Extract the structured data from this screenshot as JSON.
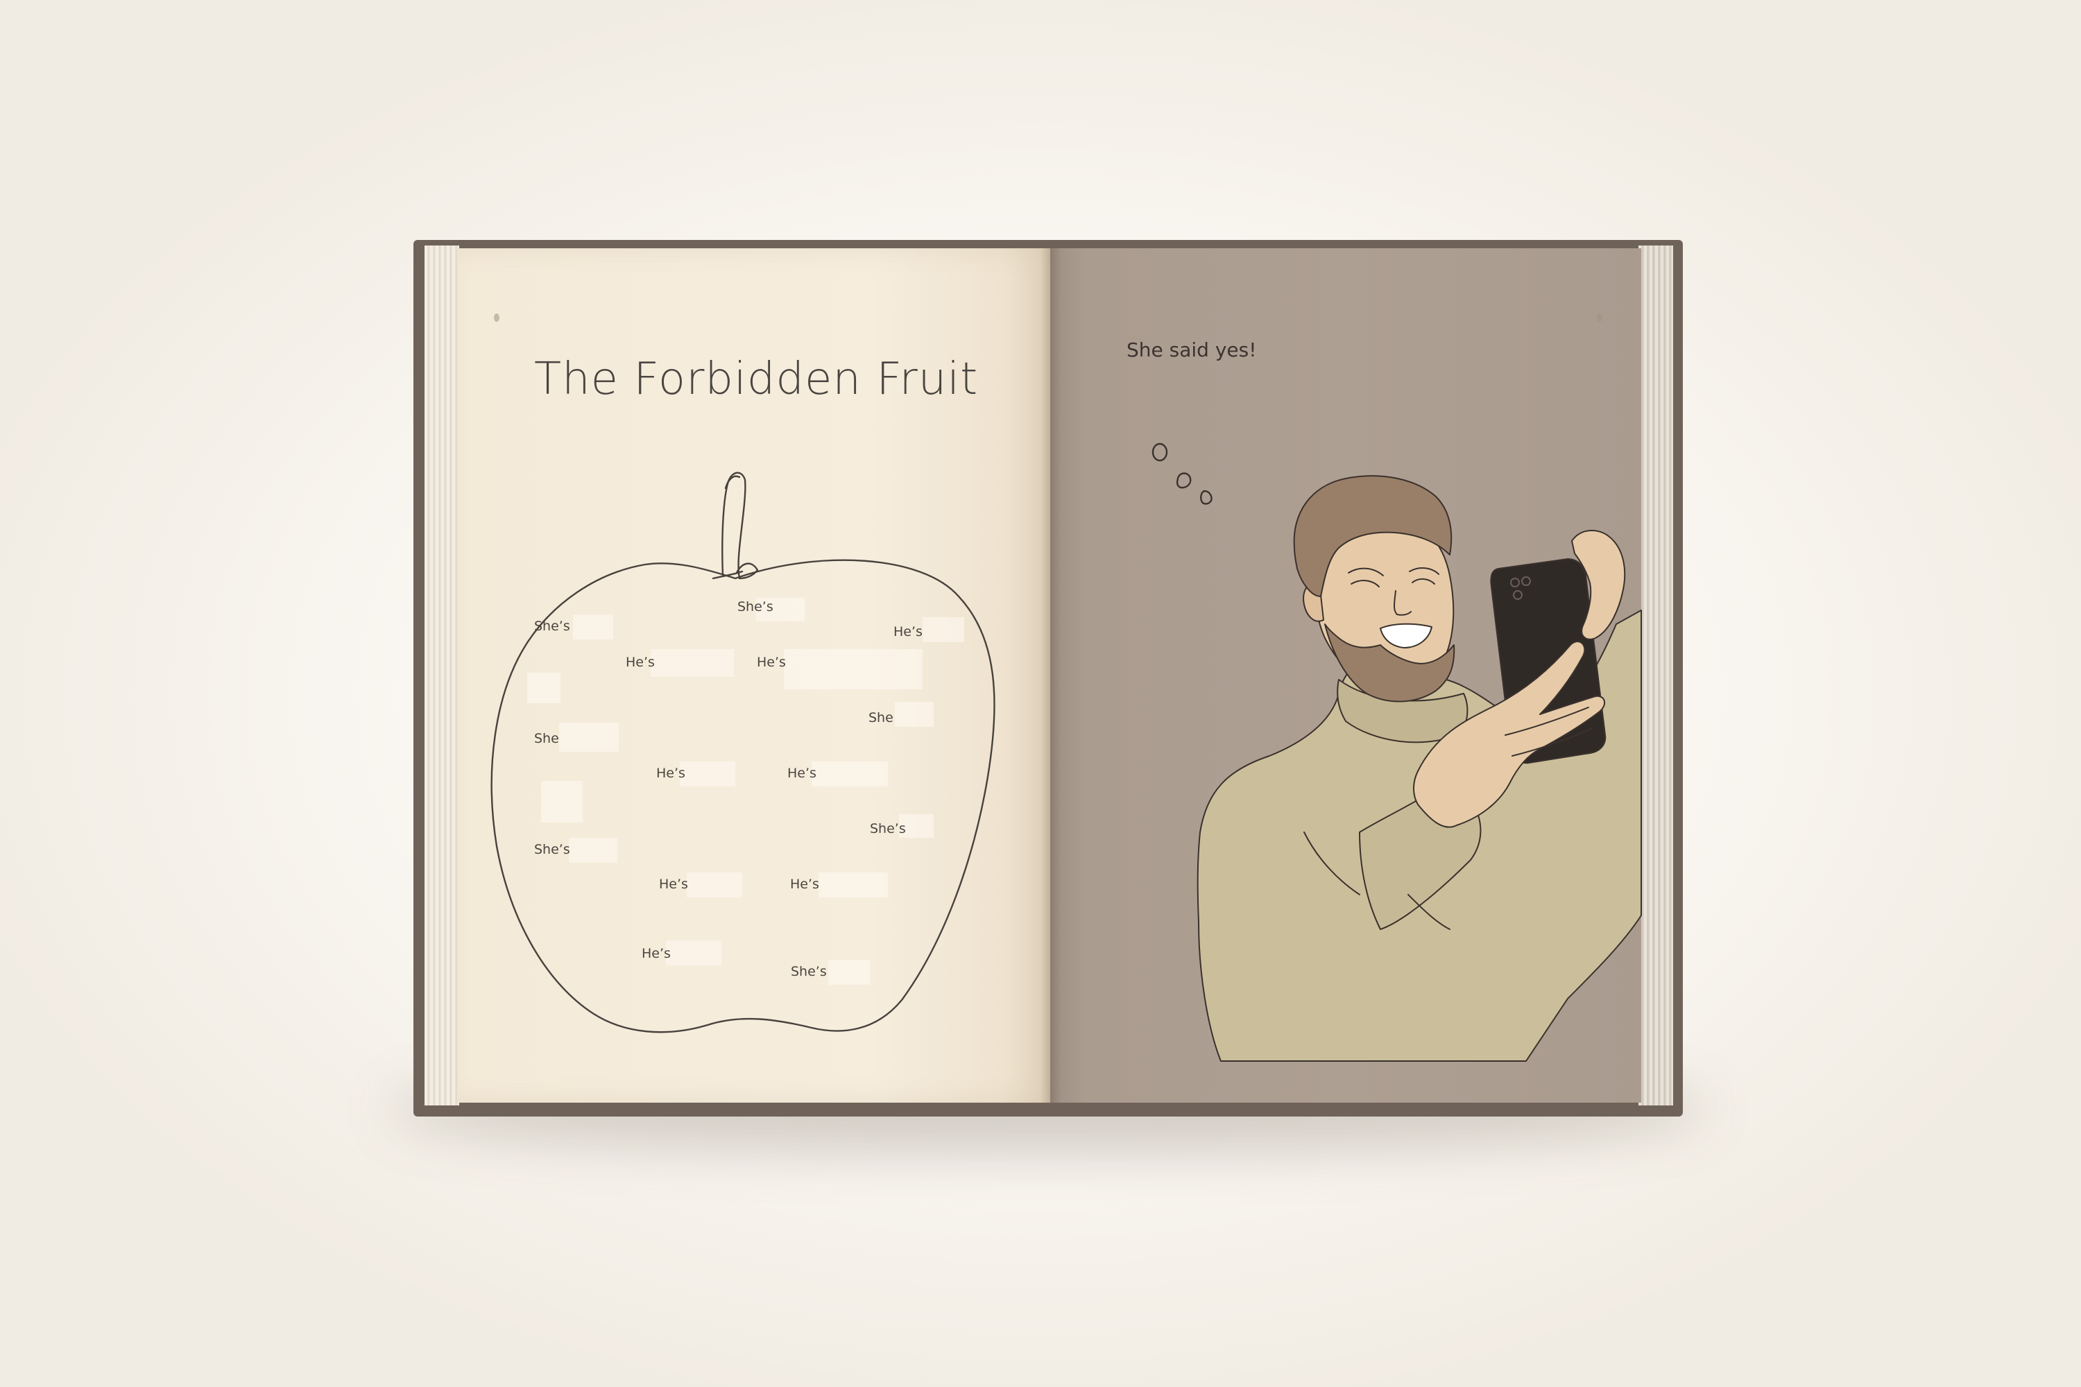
{
  "left_page": {
    "title": "The Forbidden Fruit",
    "labels": [
      "She’s",
      "She’s",
      "He’s",
      "He’s",
      "He’s",
      "She",
      "She",
      "He’s",
      "He’s",
      "She’s",
      "She’s",
      "He’s",
      "He’s",
      "He’s",
      "She’s"
    ]
  },
  "right_page": {
    "caption": "She said yes!"
  },
  "colors": {
    "left_page": "#f6eddd",
    "right_page": "#ae9f93",
    "ink": "#4a4541",
    "sweater": "#cbbf9b",
    "skin": "#e7cba9",
    "hair": "#9a7f68",
    "phone": "#302a27"
  }
}
